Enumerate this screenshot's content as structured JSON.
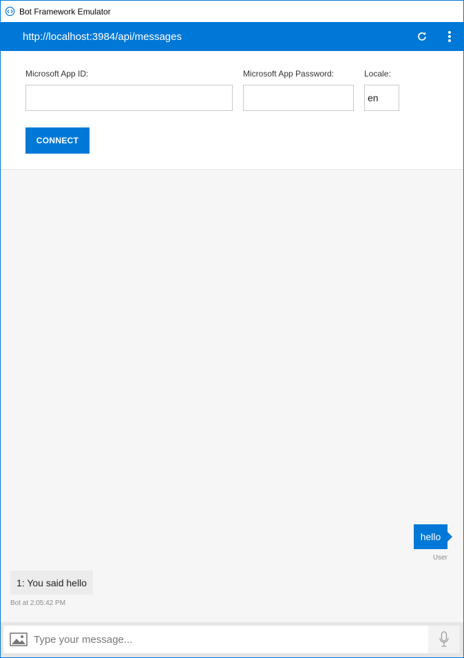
{
  "window": {
    "title": "Bot Framework Emulator"
  },
  "endpoint": {
    "url": "http://localhost:3984/api/messages"
  },
  "form": {
    "app_id_label": "Microsoft App ID:",
    "app_id_value": "",
    "app_password_label": "Microsoft App Password:",
    "app_password_value": "",
    "locale_label": "Locale:",
    "locale_value": "en",
    "connect_label": "CONNECT"
  },
  "messages": [
    {
      "from": "user",
      "text": "hello",
      "meta": "User"
    },
    {
      "from": "bot",
      "text": "1: You said hello",
      "meta": "Bot at 2:05:42 PM"
    }
  ],
  "composer": {
    "placeholder": "Type your message..."
  },
  "icons": {
    "app": "emulator-icon",
    "refresh": "refresh-icon",
    "more": "more-vertical-icon",
    "image": "image-upload-icon",
    "mic": "microphone-icon"
  },
  "colors": {
    "accent": "#0078d7",
    "chat_bg": "#f6f6f6",
    "bot_bubble": "#ececec"
  }
}
